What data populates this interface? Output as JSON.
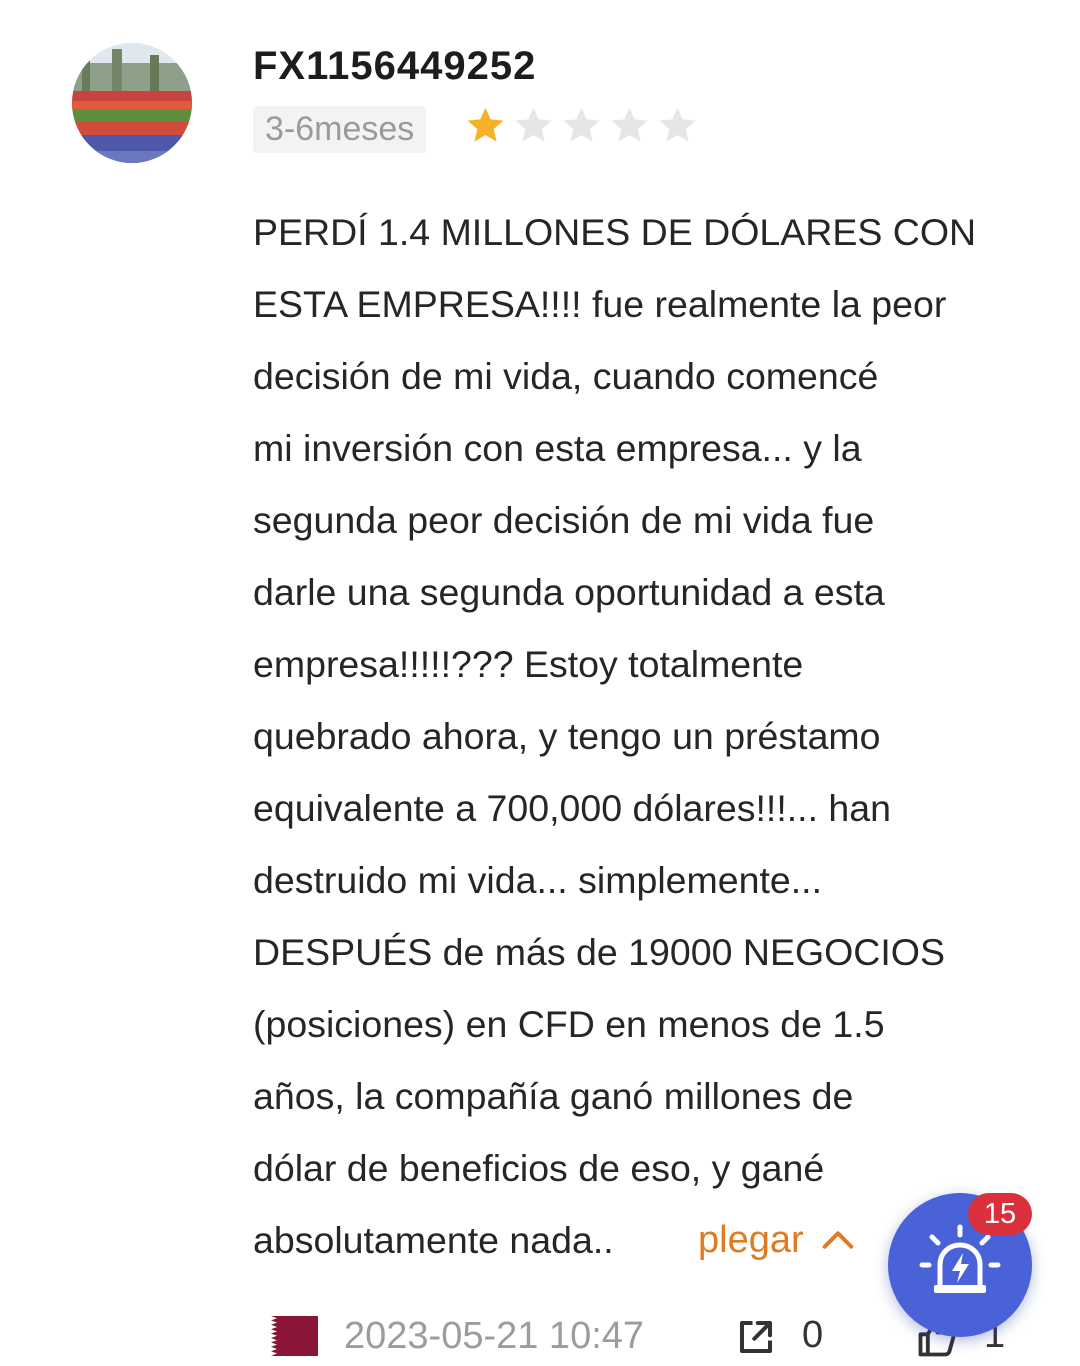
{
  "review": {
    "username": "FX1156449252",
    "duration_tag": "3-6meses",
    "rating": {
      "value": 1,
      "max": 5,
      "filled_color": "#f5b229",
      "empty_color": "#e6e6e6"
    },
    "lines": [
      "PERDÍ 1.4 MILLONES DE DÓLARES CON",
      "ESTA EMPRESA!!!! fue realmente la peor",
      "decisión de mi vida, cuando comencé",
      "mi inversión con esta empresa... y la",
      "segunda peor decisión de mi vida fue",
      "darle una segunda oportunidad a esta",
      "empresa!!!!!??? Estoy totalmente",
      "quebrado ahora, y tengo un préstamo",
      "equivalente a 700,000 dólares!!!... han",
      "destruido mi vida... simplemente...",
      "DESPUÉS de más de 19000 NEGOCIOS",
      "(posiciones) en CFD en menos de 1.5",
      "años, la compañía ganó millones de",
      "dólar de beneficios de eso, y gané",
      "absolutamente nada.."
    ],
    "collapse_label": "plegar",
    "date": "2023-05-21 10:47",
    "share_count": "0",
    "like_count": "1"
  },
  "icons": {
    "avatar": "avatar-flower-garden-photo",
    "flag": "qatar-flag-icon",
    "share": "share-icon",
    "like": "thumbs-up-icon",
    "alert": "alarm-light-icon"
  },
  "floating_alert": {
    "badge": "15"
  },
  "colors": {
    "accent_orange": "#e07b22",
    "fab_blue": "#4a62d8",
    "badge_red": "#d9303b",
    "flag_maroon": "#8a1538"
  }
}
